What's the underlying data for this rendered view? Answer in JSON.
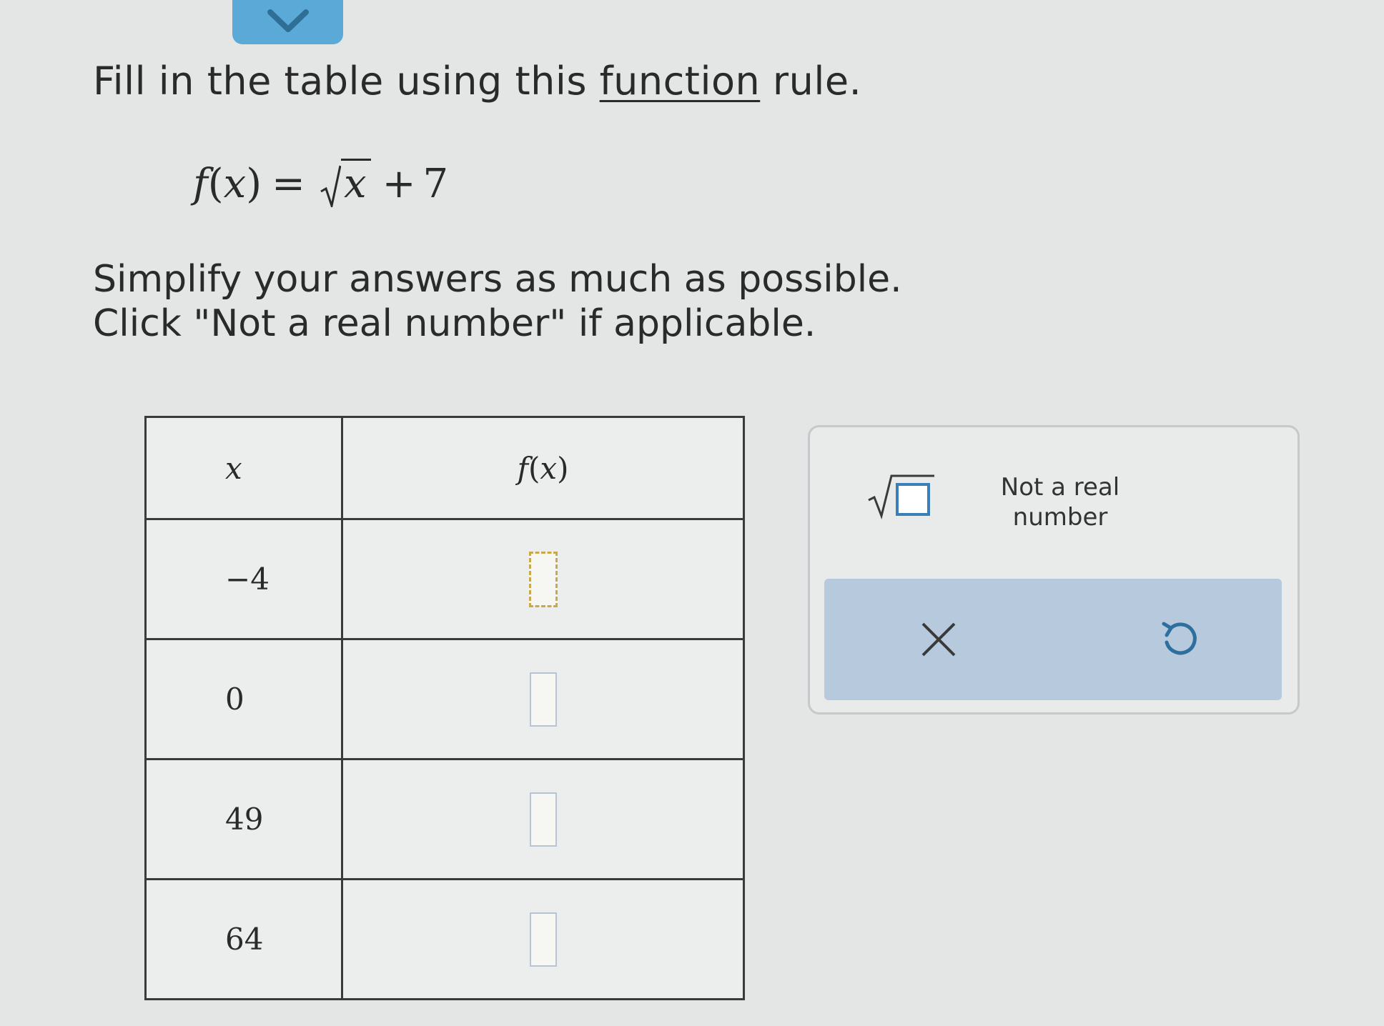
{
  "instructions": {
    "title_before": "Fill in the table using this ",
    "title_link": "function",
    "title_after": " rule.",
    "line1": "Simplify your answers as much as possible.",
    "line2": "Click \"Not a real number\" if applicable."
  },
  "formula": {
    "lhs_f": "f",
    "lhs_paren_open": "(",
    "lhs_var": "x",
    "lhs_paren_close": ")",
    "equals": "=",
    "radicand": "x",
    "plus": "+",
    "constant": "7"
  },
  "table": {
    "headers": {
      "x": "x",
      "fx_f": "f",
      "fx_open": "(",
      "fx_x": "x",
      "fx_close": ")"
    },
    "rows": [
      {
        "x": "−4",
        "value": ""
      },
      {
        "x": "0",
        "value": ""
      },
      {
        "x": "49",
        "value": ""
      },
      {
        "x": "64",
        "value": ""
      }
    ]
  },
  "panel": {
    "not_real_label": "Not a real number"
  },
  "icons": {
    "sqrt": "sqrt-template-icon",
    "clear": "x-icon",
    "undo": "undo-icon",
    "tab": "chevron-down-icon"
  },
  "colors": {
    "tab": "#5aa9d6",
    "action_bar": "#b7c9dc",
    "active_box_border": "#c9a94a"
  }
}
